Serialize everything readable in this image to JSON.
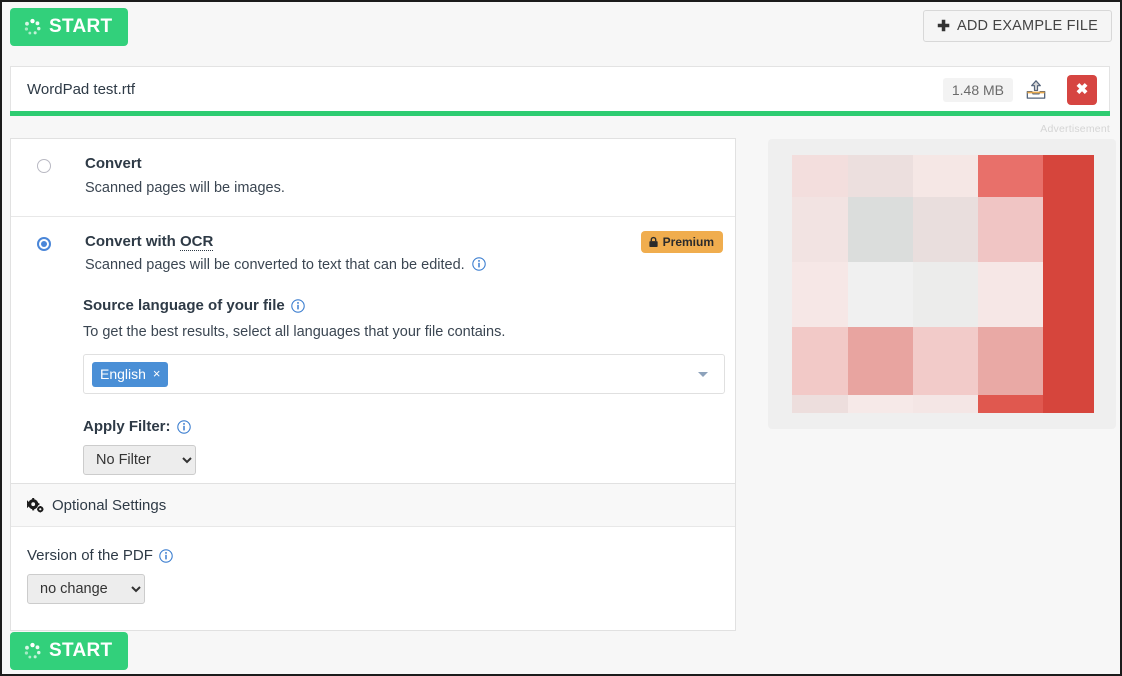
{
  "toolbar": {
    "start_label": "START",
    "start_icon": "spinner-icon",
    "add_example_label": "ADD EXAMPLE FILE",
    "add_icon": "plus-icon"
  },
  "file": {
    "name": "WordPad test.rtf",
    "size": "1.48 MB",
    "upload_icon": "cloud-upload-icon",
    "remove_icon": "close-icon",
    "remove_label": "✖"
  },
  "options": [
    {
      "id": "convert",
      "title": "Convert",
      "description": "Scanned pages will be images.",
      "selected": false
    },
    {
      "id": "convert-ocr",
      "title_pre": "Convert with ",
      "title_underlined": "OCR",
      "description": "Scanned pages will be converted to text that can be edited.",
      "selected": true,
      "badge": "Premium",
      "badge_icon": "lock-icon",
      "info_icon": "info-icon"
    }
  ],
  "ocr": {
    "language_label": "Source language of your file",
    "language_info_icon": "info-icon",
    "language_hint": "To get the best results, select all languages that your file contains.",
    "selected_languages": [
      "English"
    ],
    "chip_remove_label": "×",
    "dropdown_icon": "chevron-down-icon",
    "filter_label": "Apply Filter:",
    "filter_info_icon": "info-icon",
    "filter_value": "No Filter",
    "filter_options": [
      "No Filter"
    ]
  },
  "optional_settings": {
    "heading": "Optional Settings",
    "heading_icon": "cogs-icon",
    "version_label": "Version of the PDF",
    "version_info_icon": "info-icon",
    "version_value": "no change",
    "version_options": [
      "no change"
    ]
  },
  "advertisement": {
    "label": "Advertisement",
    "colors": {
      "accent_red": "#d6453c",
      "pink_1": "#f6dedd",
      "pink_2": "#f2dede",
      "pink_3": "#f7e6e4",
      "pink_4": "#f0c5c4",
      "grey": "#dbdddc",
      "light": "#f0f0f0"
    }
  },
  "theme": {
    "green": "#32d07b",
    "underline_green": "#2ecc71",
    "blue": "#4a86d8",
    "chip_blue": "#4a8fd6",
    "premium_orange": "#f0ad4e",
    "remove_red": "#d64541"
  }
}
